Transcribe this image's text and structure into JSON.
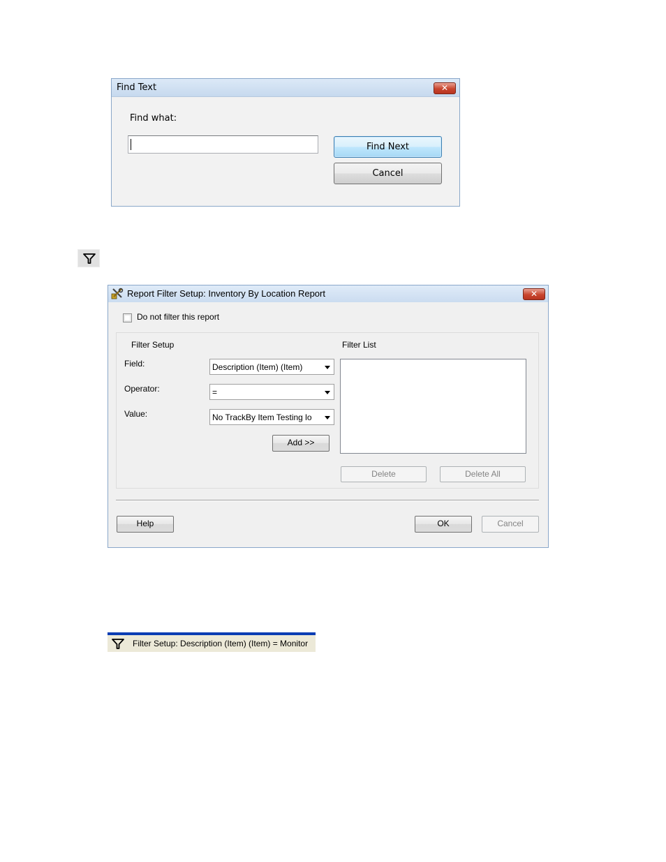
{
  "find_dialog": {
    "title": "Find Text",
    "close_glyph": "✕",
    "find_what_label": "Find what:",
    "find_what_value": "",
    "find_next_label": "Find Next",
    "cancel_label": "Cancel"
  },
  "filter_icon": {
    "icon": "funnel-icon"
  },
  "report_dialog": {
    "title": "Report Filter Setup: Inventory By Location Report",
    "app_icon": "tools-app-icon",
    "close_glyph": "✕",
    "do_not_filter_label": "Do not filter this report",
    "do_not_filter_checked": false,
    "filter_setup_heading": "Filter Setup",
    "filter_list_heading": "Filter List",
    "field_label": "Field:",
    "field_value": "Description (Item) (Item)",
    "operator_label": "Operator:",
    "operator_value": "=",
    "value_label": "Value:",
    "value_value": "No TrackBy Item   Testing lo",
    "add_label": "Add >>",
    "delete_label": "Delete",
    "delete_all_label": "Delete All",
    "help_label": "Help",
    "ok_label": "OK",
    "cancel_label": "Cancel",
    "filter_list_items": []
  },
  "status_strip": {
    "text": "Filter Setup: Description (Item) (Item) = Monitor",
    "icon": "funnel-icon"
  },
  "colors": {
    "titlebar": "#cbdcf0",
    "close_button": "#c8452e",
    "status_bar_accent": "#0a3db3"
  }
}
